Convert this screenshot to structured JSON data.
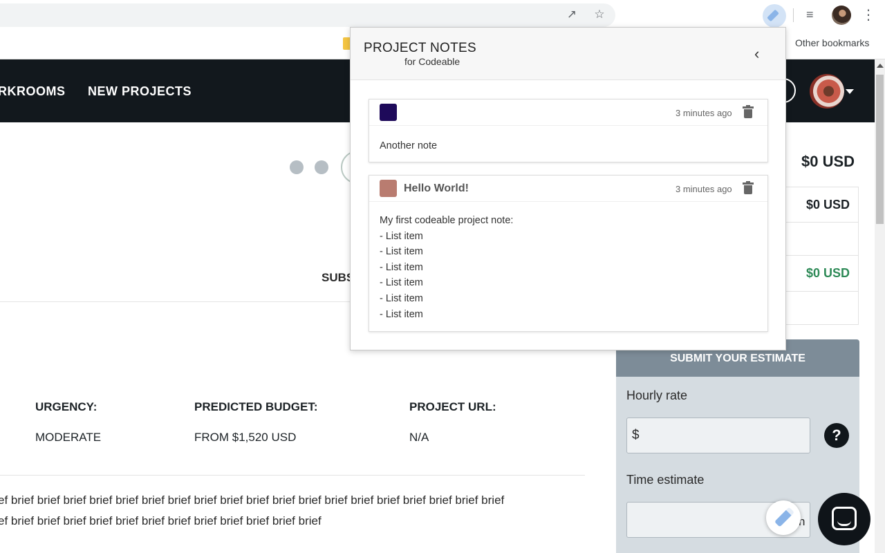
{
  "browser": {
    "omnibox_icons": [
      "open-in-external-icon",
      "bookmark-star-icon"
    ],
    "toolbar_icons": [
      "pencil-extension-icon",
      "media-controls-icon",
      "profile-avatar",
      "more-options-icon"
    ],
    "bookmarks_bar": {
      "other_bookmarks": "Other bookmarks"
    }
  },
  "site_header": {
    "nav": [
      "RKROOMS",
      "NEW PROJECTS"
    ],
    "bg_color": "#12181d"
  },
  "main": {
    "submit_tab_partial": "SUBS",
    "meta": [
      {
        "label": "URGENCY:",
        "value": "MODERATE"
      },
      {
        "label": "PREDICTED BUDGET:",
        "value": "FROM $1,520 USD"
      },
      {
        "label": "PROJECT URL:",
        "value": "N/A"
      }
    ],
    "brief_lines": [
      "ef brief brief brief brief brief brief brief brief brief brief brief brief brief brief brief brief brief brief brief",
      "ef brief brief brief brief brief brief brief brief brief brief brief brief"
    ]
  },
  "right_panel": {
    "total": "$0 USD",
    "rows": [
      {
        "value": "$0 USD",
        "color": "#1c2226"
      },
      {
        "value": "",
        "color": "#1c2226"
      },
      {
        "value": "$0 USD",
        "color": "#2e8a57"
      },
      {
        "value": "",
        "color": "#1c2226"
      }
    ],
    "estimate": {
      "title": "SUBMIT YOUR ESTIMATE",
      "hourly_label": "Hourly rate",
      "hourly_value": "$",
      "time_label": "Time estimate",
      "time_value": "",
      "time_unit_partial": "n",
      "help": "?"
    }
  },
  "popup": {
    "title": "PROJECT NOTES",
    "subtitle": "for Codeable",
    "back_icon": "chevron-left-icon",
    "notes": [
      {
        "color": "#1e0a5a",
        "title": "",
        "time": "3 minutes ago",
        "body": "Another note"
      },
      {
        "color": "#b97c70",
        "title": "Hello World!",
        "time": "3 minutes ago",
        "body": "My first codeable project note:\n- List item\n- List item\n- List item\n- List item\n- List item\n- List item"
      }
    ]
  }
}
